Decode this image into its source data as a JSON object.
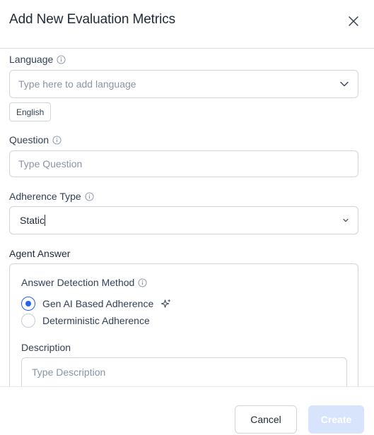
{
  "modal": {
    "title": "Add New Evaluation Metrics"
  },
  "language": {
    "label": "Language",
    "placeholder": "Type here to add language",
    "chips": [
      "English"
    ]
  },
  "question": {
    "label": "Question",
    "placeholder": "Type Question"
  },
  "adherence_type": {
    "label": "Adherence Type",
    "value": "Static"
  },
  "agent_answer": {
    "title": "Agent Answer",
    "detection_label": "Answer Detection Method",
    "options": [
      {
        "label": "Gen AI Based Adherence",
        "selected": true
      },
      {
        "label": "Deterministic Adherence",
        "selected": false
      }
    ],
    "description_label": "Description",
    "description_placeholder": "Type Description"
  },
  "footer": {
    "cancel_label": "Cancel",
    "create_label": "Create"
  },
  "colors": {
    "accent": "#2563eb",
    "border": "#d0d5dd",
    "create_disabled": "#d7e4fb"
  },
  "icons": {
    "close": "close-icon",
    "info": "info-icon",
    "chevron": "chevron-down-icon",
    "sparkle": "sparkle-icon"
  }
}
